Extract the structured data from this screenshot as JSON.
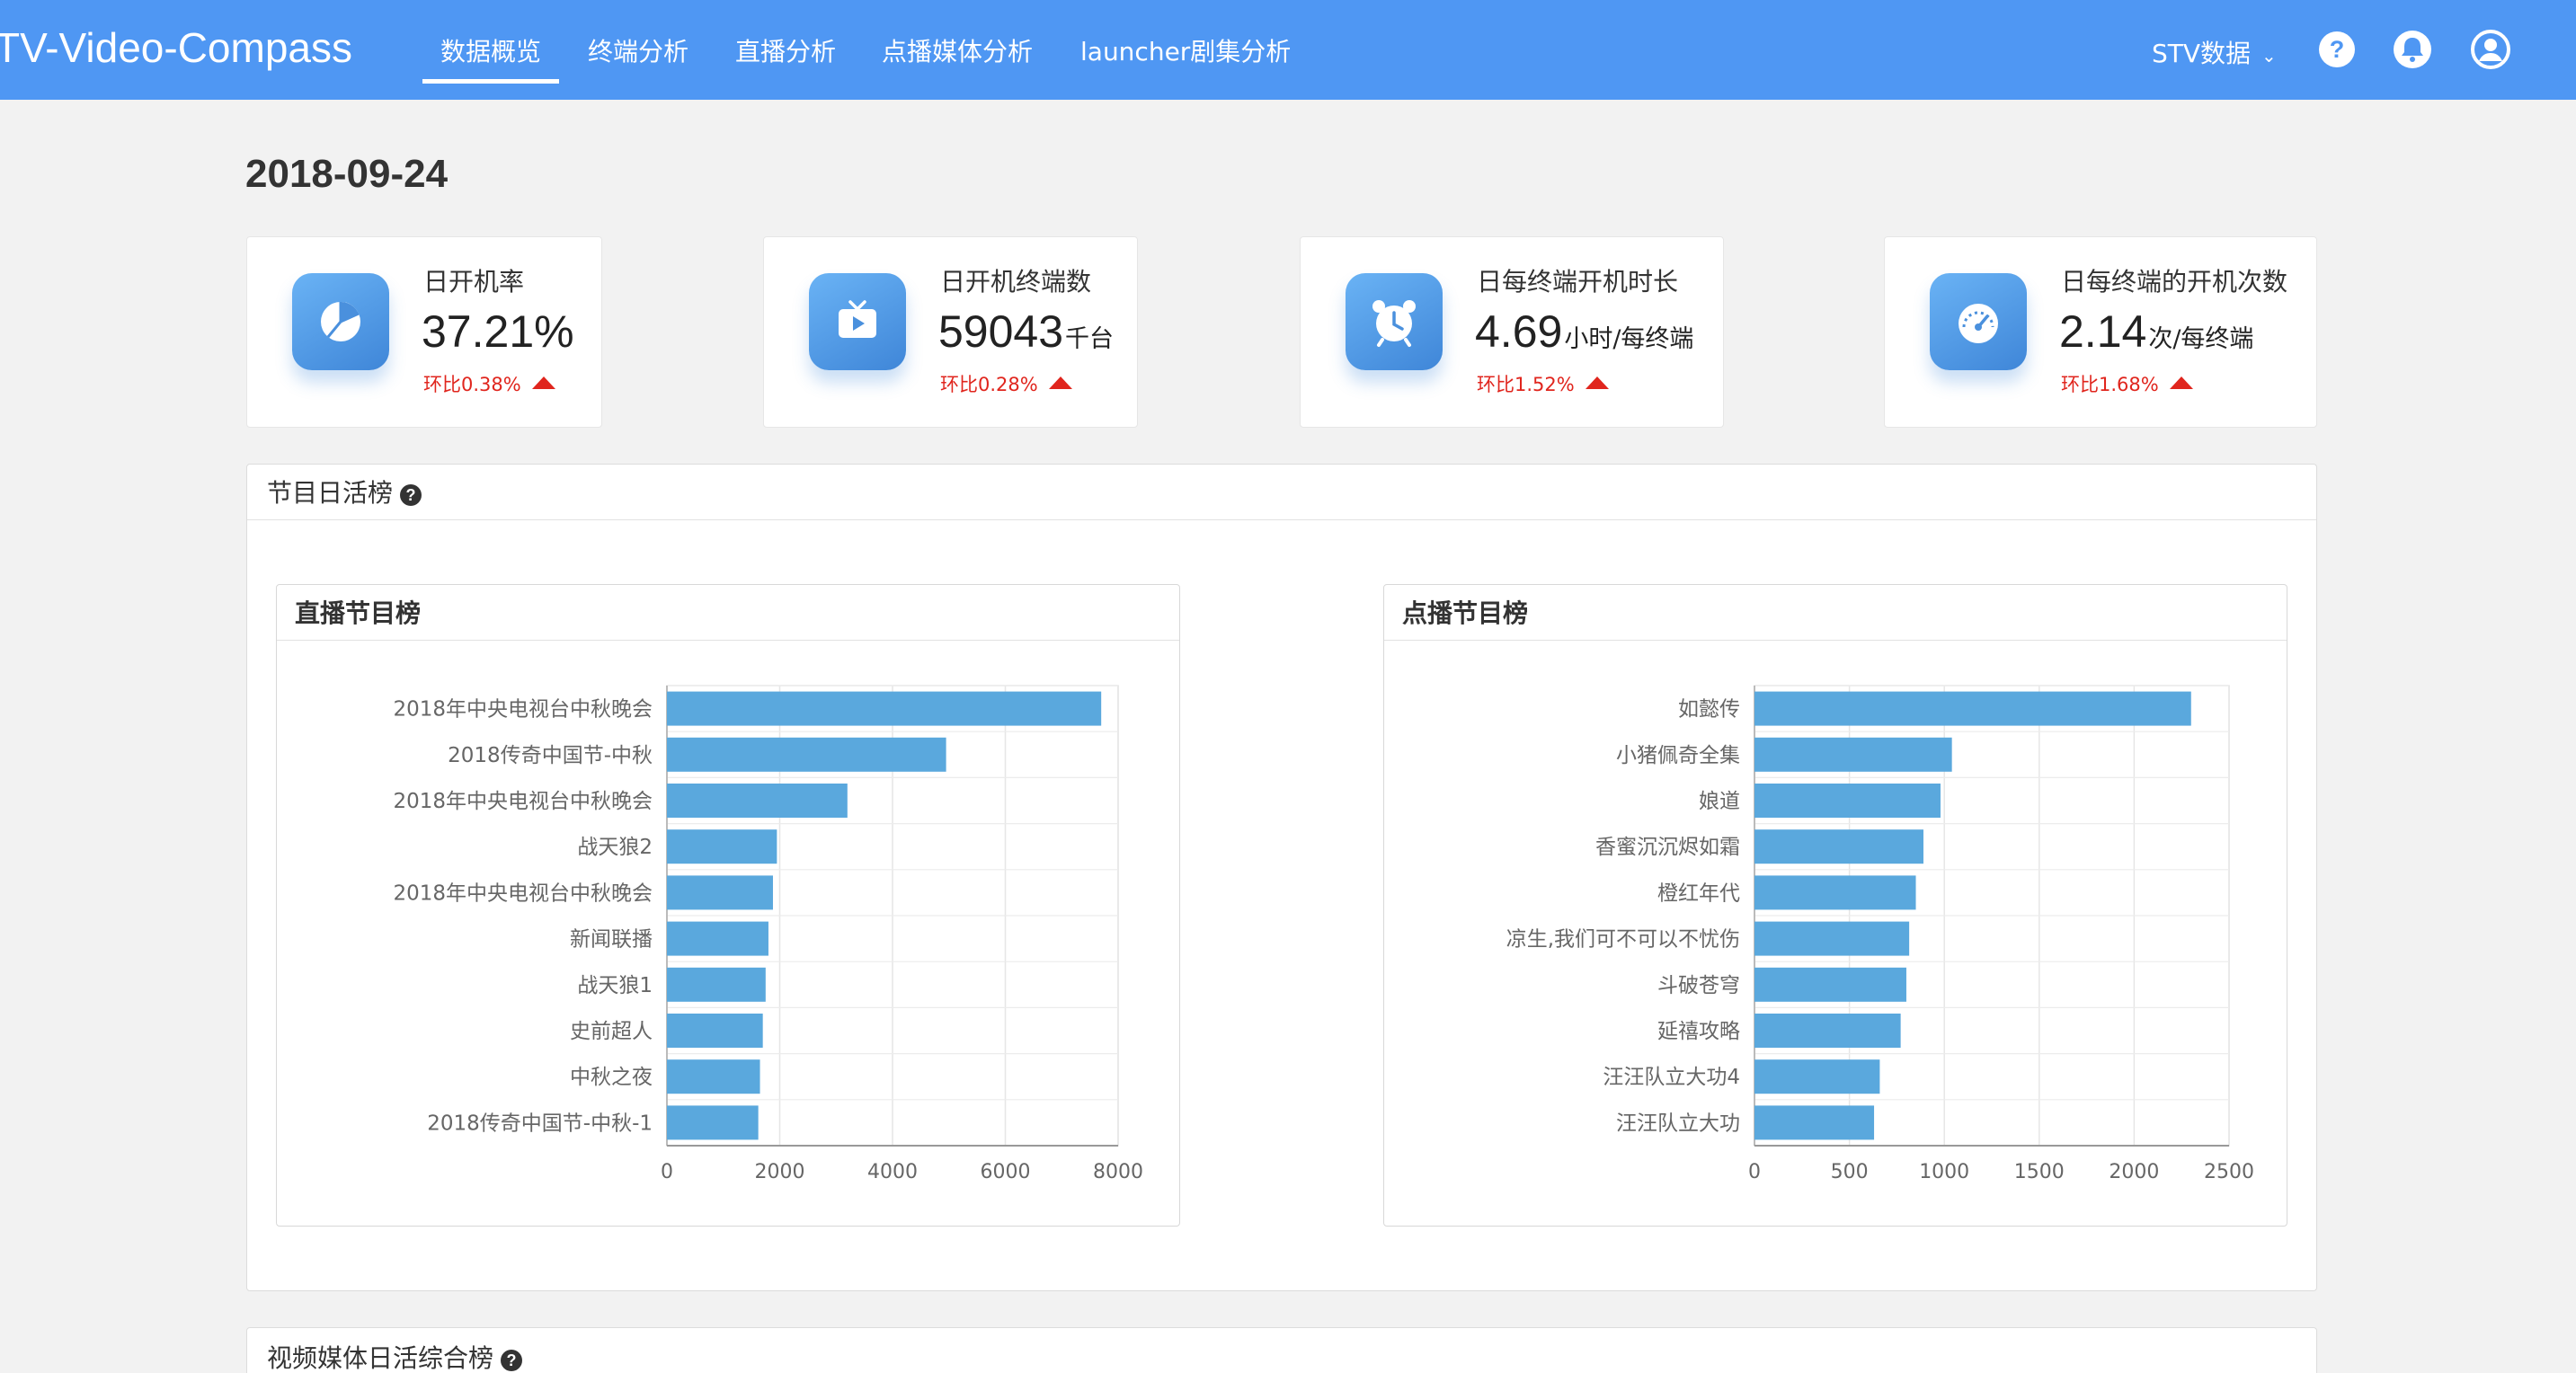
{
  "header": {
    "brand": "TV-Video-Compass",
    "nav": [
      {
        "label": "数据概览",
        "active": true
      },
      {
        "label": "终端分析",
        "active": false
      },
      {
        "label": "直播分析",
        "active": false
      },
      {
        "label": "点播媒体分析",
        "active": false
      },
      {
        "label": "launcher剧集分析",
        "active": false
      }
    ],
    "user_menu": "STV数据",
    "icons": [
      "help-icon",
      "bell-icon",
      "user-icon"
    ]
  },
  "date": "2018-09-24",
  "kpis": [
    {
      "icon": "pie-chart-icon",
      "label": "日开机率",
      "value": "37.21%",
      "unit": "",
      "change": "环比0.38%",
      "trend": "up"
    },
    {
      "icon": "tv-play-icon",
      "label": "日开机终端数",
      "value": "59043",
      "unit": "千台",
      "change": "环比0.28%",
      "trend": "up"
    },
    {
      "icon": "alarm-clock-icon",
      "label": "日每终端开机时长",
      "value": "4.69",
      "unit": "小时/每终端",
      "change": "环比1.52%",
      "trend": "up"
    },
    {
      "icon": "gauge-icon",
      "label": "日每终端的开机次数",
      "value": "2.14",
      "unit": "次/每终端",
      "change": "环比1.68%",
      "trend": "up"
    }
  ],
  "panels": {
    "daily_active": {
      "title": "节目日活榜"
    },
    "media_overall": {
      "title": "视频媒体日活综合榜"
    }
  },
  "colors": {
    "topbar": "#4f97f3",
    "bar": "#5aa8dd",
    "up_red": "#e0251d",
    "icon_badge": "#4a90dd"
  },
  "chart_data": [
    {
      "type": "bar",
      "orientation": "horizontal",
      "title": "直播节目榜",
      "categories": [
        "2018年中央电视台中秋晚会",
        "2018传奇中国节-中秋",
        "2018年中央电视台中秋晚会",
        "战天狼2",
        "2018年中央电视台中秋晚会",
        "新闻联播",
        "战天狼1",
        "史前超人",
        "中秋之夜",
        "2018传奇中国节-中秋-1"
      ],
      "values": [
        7700,
        4950,
        3200,
        1950,
        1880,
        1800,
        1750,
        1700,
        1650,
        1620
      ],
      "xticks": [
        "0",
        "2000",
        "4000",
        "6000",
        "8000"
      ],
      "xlim": [
        0,
        8000
      ],
      "grid": true
    },
    {
      "type": "bar",
      "orientation": "horizontal",
      "title": "点播节目榜",
      "categories": [
        "如懿传",
        "小猪佩奇全集",
        "娘道",
        "香蜜沉沉烬如霜",
        "橙红年代",
        "凉生,我们可不可以不忧伤",
        "斗破苍穹",
        "延禧攻略",
        "汪汪队立大功4",
        "汪汪队立大功"
      ],
      "values": [
        2300,
        1040,
        980,
        890,
        850,
        815,
        800,
        770,
        660,
        630
      ],
      "xticks": [
        "0",
        "500",
        "1000",
        "1500",
        "2000",
        "2500"
      ],
      "xlim": [
        0,
        2500
      ],
      "grid": true
    }
  ]
}
